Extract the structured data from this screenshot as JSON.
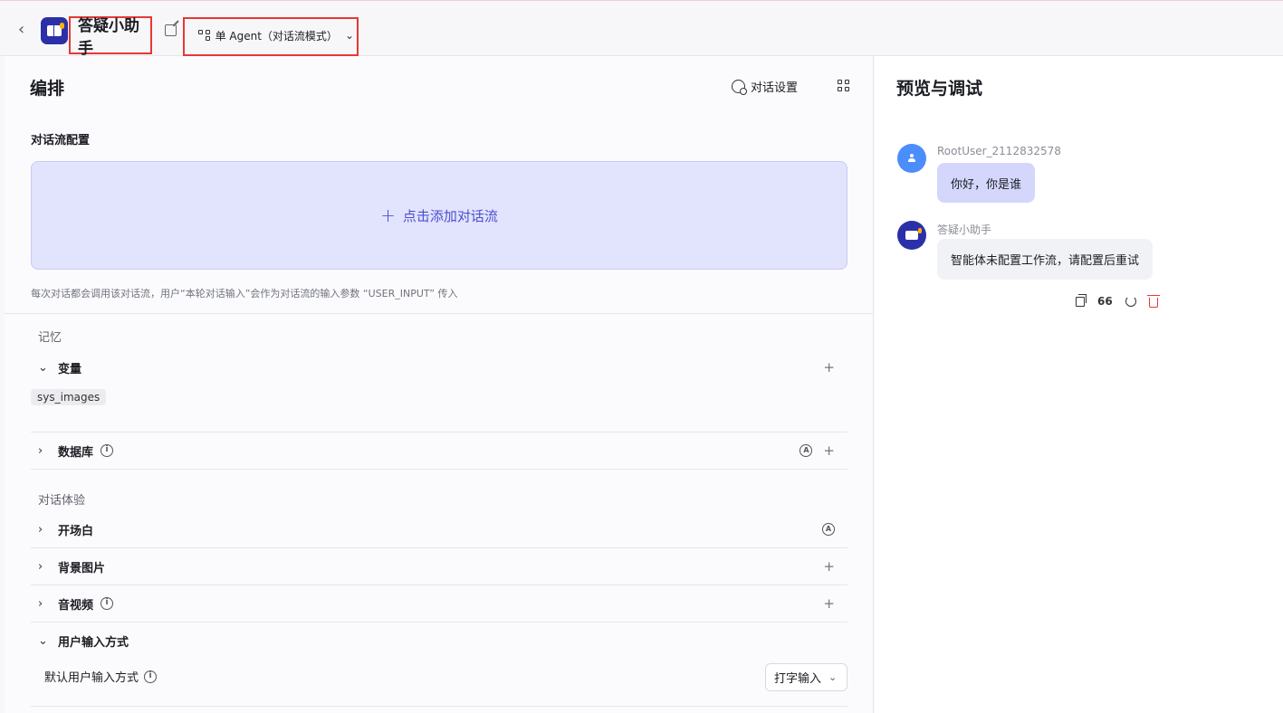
{
  "header": {
    "back": "‹",
    "app_title": "答疑小助手",
    "mode_label": "单 Agent（对话流模式）",
    "mode_chevron": "⌄"
  },
  "left": {
    "title": "编排",
    "settings_label": "对话设置",
    "flow_section": "对话流配置",
    "add_flow_label": "点击添加对话流",
    "hint": "每次对话都会调用该对话流，用户“本轮对话输入”会作为对话流的输入参数 “USER_INPUT” 传入",
    "memory_group": "记忆",
    "variables_label": "变量",
    "variable_tag": "sys_images",
    "database_label": "数据库",
    "experience_group": "对话体验",
    "opening_label": "开场白",
    "background_label": "背景图片",
    "av_label": "音视频",
    "input_mode_label": "用户输入方式",
    "default_input_label": "默认用户输入方式",
    "default_input_value": "打字输入",
    "plus": "+",
    "chev_right": "›",
    "chev_down": "⌄",
    "info": "i",
    "auto": "A"
  },
  "right": {
    "title": "预览与调试",
    "user_name": "RootUser_2112832578",
    "user_message": "你好，你是谁",
    "bot_name": "答疑小助手",
    "bot_message": "智能体未配置工作流，请配置后重试",
    "quote_count": "66"
  },
  "colors": {
    "accent": "#4b4fd1",
    "flow_bg": "#e2e3fc",
    "highlight": "#e53935",
    "delete": "#e53935",
    "user_bubble": "#d4d6fc"
  },
  "icons": [
    "back-icon",
    "app-logo",
    "edit-icon",
    "workflow-icon",
    "chevron-down-icon",
    "chat-settings-icon",
    "layout-grid-icon",
    "plus-icon",
    "info-icon",
    "auto-icon",
    "user-avatar-icon",
    "bot-avatar-icon",
    "copy-icon",
    "refresh-icon",
    "trash-icon"
  ]
}
